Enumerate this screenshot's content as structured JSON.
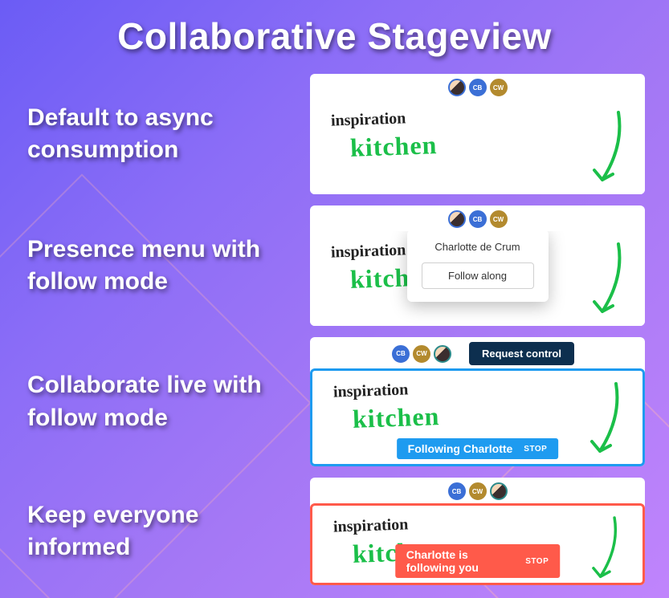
{
  "title": "Collaborative Stageview",
  "rows": [
    {
      "label": "Default to async consumption"
    },
    {
      "label": "Presence menu with follow mode"
    },
    {
      "label": "Collaborate live with follow mode"
    },
    {
      "label": "Keep everyone informed"
    }
  ],
  "ink": {
    "inspiration": "inspiration",
    "kitchen": "kitchen"
  },
  "avatars": {
    "cb": "CB",
    "cw": "CW"
  },
  "popover": {
    "name": "Charlotte de Crum",
    "button": "Follow along"
  },
  "request_control": "Request control",
  "following_status": {
    "label": "Following Charlotte",
    "stop": "STOP"
  },
  "followed_status": {
    "label": "Charlotte is following you",
    "stop": "STOP"
  },
  "colors": {
    "blue": "#1e9bf0",
    "red": "#ff5a4a",
    "ink_green": "#1bbf49"
  }
}
